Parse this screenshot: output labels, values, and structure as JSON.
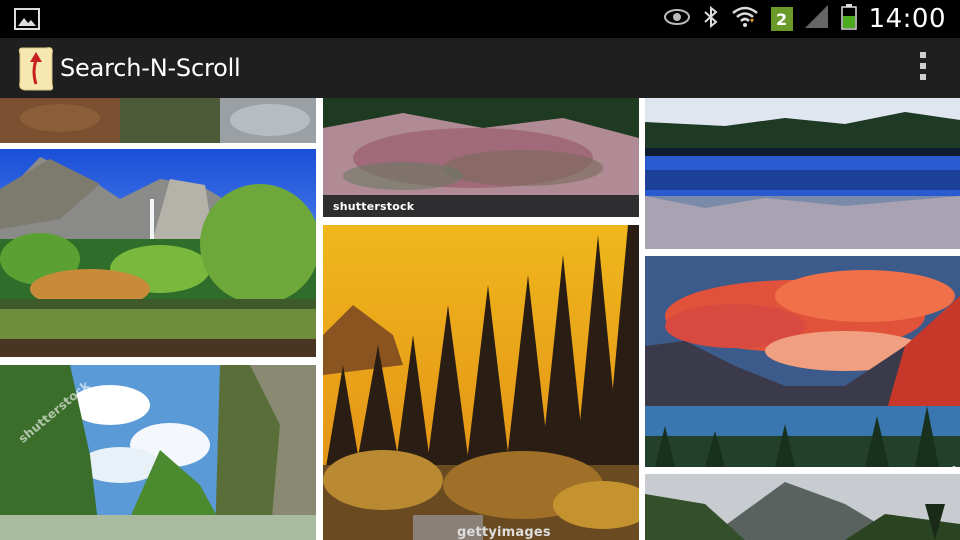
{
  "status_bar": {
    "time": "14:00",
    "sim_badge": "2",
    "icons": [
      "gallery-notification-icon",
      "eye-icon",
      "bluetooth-icon",
      "wifi-icon",
      "signal-icon",
      "battery-icon"
    ]
  },
  "action_bar": {
    "title": "Search-N-Scroll",
    "menu_icon": "overflow-menu-icon",
    "colors": {
      "background": "#1f1f1f",
      "status": "#000000"
    }
  },
  "grid": {
    "images": [
      {
        "subject": "forest-floor-rocks"
      },
      {
        "subject": "yosemite-falls-valley"
      },
      {
        "subject": "green-karst-mountains",
        "watermark": "shutterstock"
      },
      {
        "subject": "reflected-mountain-lake",
        "watermark": "shutterstock"
      },
      {
        "subject": "autumn-forest-orange-sky",
        "watermark": "gettyimages"
      },
      {
        "subject": "mountain-lake-blue-reflection"
      },
      {
        "subject": "red-clouds-glacier-lake"
      },
      {
        "subject": "misty-mountain-palms"
      }
    ]
  }
}
